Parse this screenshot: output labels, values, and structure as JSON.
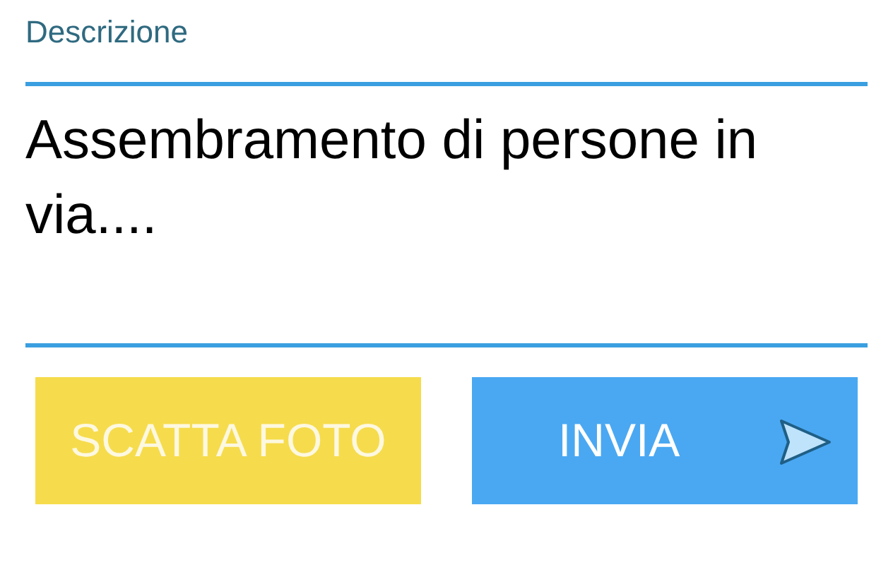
{
  "field": {
    "label": "Descrizione",
    "value": "Assembramento di persone in via...."
  },
  "buttons": [
    {
      "kind": "photo",
      "label": "SCATTA FOTO"
    },
    {
      "kind": "send",
      "label": "INVIA"
    }
  ]
}
